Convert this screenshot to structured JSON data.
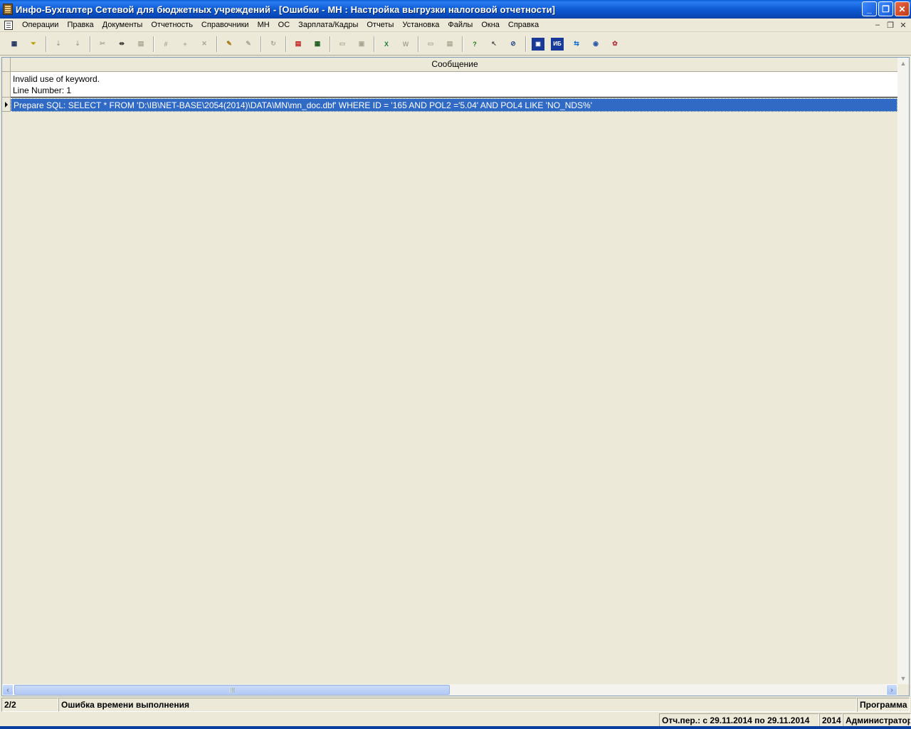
{
  "window": {
    "title": "Инфо-Бухгалтер Сетевой для бюджетных учреждений - [Ошибки - МН : Настройка выгрузки налоговой отчетности]"
  },
  "menu": {
    "items": [
      "Операции",
      "Правка",
      "Документы",
      "Отчетность",
      "Справочники",
      "МН",
      "ОС",
      "Зарплата/Кадры",
      "Отчеты",
      "Установка",
      "Файлы",
      "Окна",
      "Справка"
    ]
  },
  "toolbar": {
    "buttons": [
      {
        "name": "list-icon",
        "glyph": "▦",
        "enabled": true
      },
      {
        "name": "filter-icon",
        "glyph": "⏷",
        "enabled": true
      },
      {
        "name": "sort-asc-icon",
        "glyph": "⇣",
        "enabled": false
      },
      {
        "name": "sort-desc-icon",
        "glyph": "⇣",
        "enabled": false
      },
      {
        "name": "cut-icon",
        "glyph": "✂",
        "enabled": false
      },
      {
        "name": "split-icon",
        "glyph": "⇹",
        "enabled": true
      },
      {
        "name": "paste-icon",
        "glyph": "▤",
        "enabled": false
      },
      {
        "name": "numbering-icon",
        "glyph": "#",
        "enabled": false
      },
      {
        "name": "add-icon",
        "glyph": "+",
        "enabled": false
      },
      {
        "name": "delete-icon",
        "glyph": "✕",
        "enabled": false
      },
      {
        "name": "highlight-icon",
        "glyph": "✎",
        "enabled": true
      },
      {
        "name": "replace-icon",
        "glyph": "✎",
        "enabled": false
      },
      {
        "name": "refresh-icon",
        "glyph": "↻",
        "enabled": false
      },
      {
        "name": "pdf-icon",
        "glyph": "▤",
        "enabled": true
      },
      {
        "name": "calculator-icon",
        "glyph": "▦",
        "enabled": true
      },
      {
        "name": "open-folder-icon",
        "glyph": "▭",
        "enabled": false
      },
      {
        "name": "save-icon",
        "glyph": "▣",
        "enabled": false
      },
      {
        "name": "excel-icon",
        "glyph": "X",
        "enabled": true
      },
      {
        "name": "word-icon",
        "glyph": "W",
        "enabled": false
      },
      {
        "name": "print-icon",
        "glyph": "▭",
        "enabled": false
      },
      {
        "name": "preview-icon",
        "glyph": "▤",
        "enabled": false
      },
      {
        "name": "help-icon",
        "glyph": "?",
        "enabled": true
      },
      {
        "name": "context-help-icon",
        "glyph": "↖",
        "enabled": true
      },
      {
        "name": "compass-icon",
        "glyph": "⊘",
        "enabled": true
      },
      {
        "name": "app-logo-icon",
        "glyph": "▣",
        "enabled": true
      },
      {
        "name": "ib10-icon",
        "glyph": "ИБ",
        "enabled": true
      },
      {
        "name": "teamviewer-icon",
        "glyph": "⇆",
        "enabled": true
      },
      {
        "name": "web-icon",
        "glyph": "◉",
        "enabled": true
      },
      {
        "name": "network-icon",
        "glyph": "✿",
        "enabled": true
      }
    ]
  },
  "grid": {
    "column_header": "Сообщение",
    "rows": [
      {
        "lines": [
          "Invalid use of keyword.",
          "Line Number: 1"
        ],
        "selected": false
      },
      {
        "lines": [
          "Prepare SQL: SELECT * FROM 'D:\\IB\\NET-BASE\\2054(2014)\\DATA\\MN\\mn_doc.dbf' WHERE ID = '165 AND POL2 ='5.04' AND POL4 LIKE 'NO_NDS%'"
        ],
        "selected": true
      }
    ]
  },
  "status": {
    "record": "2/2",
    "message": "Ошибка времени выполнения",
    "source": "Программа",
    "period": "Отч.пер.: с 29.11.2014 по 29.11.2014",
    "year": "2014",
    "user": "Администратор"
  },
  "colors": {
    "selection": "#316ac5",
    "titlebar": "#0a5fd8",
    "face": "#ece9d8"
  }
}
